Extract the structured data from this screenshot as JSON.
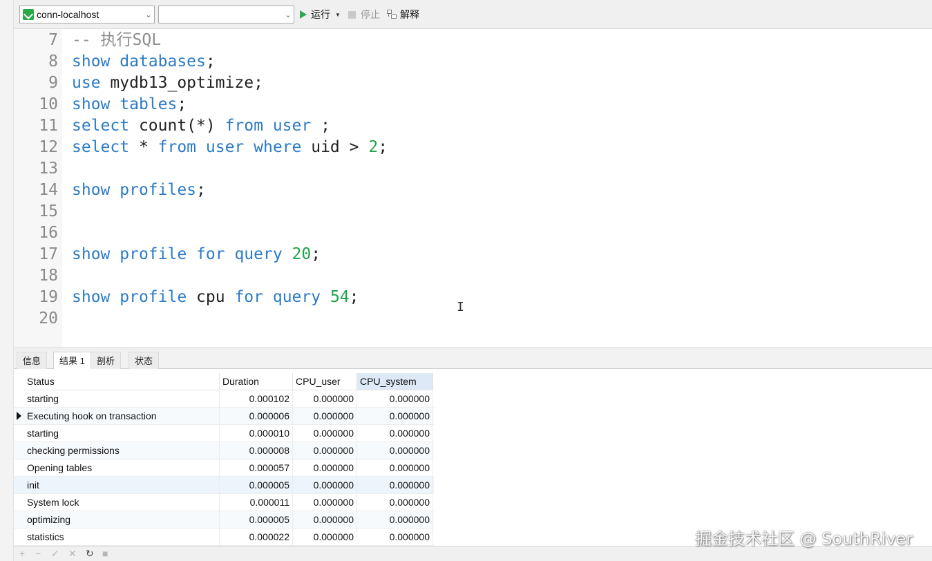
{
  "toolbar": {
    "connection": "conn-localhost",
    "database": "",
    "run_label": "运行",
    "stop_label": "停止",
    "explain_label": "解释"
  },
  "editor": {
    "lines": [
      {
        "num": "7",
        "tokens": [
          {
            "t": "-- 执行SQL",
            "c": "cm"
          }
        ]
      },
      {
        "num": "8",
        "tokens": [
          {
            "t": "show",
            "c": "kw"
          },
          {
            "t": " "
          },
          {
            "t": "databases",
            "c": "kw"
          },
          {
            "t": ";"
          }
        ]
      },
      {
        "num": "9",
        "tokens": [
          {
            "t": "use",
            "c": "kw"
          },
          {
            "t": " mydb13_optimize;"
          }
        ]
      },
      {
        "num": "10",
        "tokens": [
          {
            "t": "show",
            "c": "kw"
          },
          {
            "t": " "
          },
          {
            "t": "tables",
            "c": "kw"
          },
          {
            "t": ";"
          }
        ]
      },
      {
        "num": "11",
        "tokens": [
          {
            "t": "select",
            "c": "kw"
          },
          {
            "t": " count(*) "
          },
          {
            "t": "from",
            "c": "kw"
          },
          {
            "t": " "
          },
          {
            "t": "user",
            "c": "kw"
          },
          {
            "t": " ;"
          }
        ]
      },
      {
        "num": "12",
        "tokens": [
          {
            "t": "select",
            "c": "kw"
          },
          {
            "t": " * "
          },
          {
            "t": "from",
            "c": "kw"
          },
          {
            "t": " "
          },
          {
            "t": "user",
            "c": "kw"
          },
          {
            "t": " "
          },
          {
            "t": "where",
            "c": "kw"
          },
          {
            "t": " uid > "
          },
          {
            "t": "2",
            "c": "num"
          },
          {
            "t": ";"
          }
        ]
      },
      {
        "num": "13",
        "tokens": []
      },
      {
        "num": "14",
        "tokens": [
          {
            "t": "show",
            "c": "kw"
          },
          {
            "t": " "
          },
          {
            "t": "profiles",
            "c": "kw"
          },
          {
            "t": ";"
          }
        ]
      },
      {
        "num": "15",
        "tokens": []
      },
      {
        "num": "16",
        "tokens": []
      },
      {
        "num": "17",
        "tokens": [
          {
            "t": "show",
            "c": "kw"
          },
          {
            "t": " "
          },
          {
            "t": "profile",
            "c": "kw"
          },
          {
            "t": " "
          },
          {
            "t": "for",
            "c": "kw"
          },
          {
            "t": " "
          },
          {
            "t": "query",
            "c": "kw"
          },
          {
            "t": " "
          },
          {
            "t": "20",
            "c": "num"
          },
          {
            "t": ";"
          }
        ]
      },
      {
        "num": "18",
        "tokens": []
      },
      {
        "num": "19",
        "tokens": [
          {
            "t": "show",
            "c": "kw"
          },
          {
            "t": " "
          },
          {
            "t": "profile",
            "c": "kw"
          },
          {
            "t": " cpu "
          },
          {
            "t": "for",
            "c": "kw"
          },
          {
            "t": " "
          },
          {
            "t": "query",
            "c": "kw"
          },
          {
            "t": " "
          },
          {
            "t": "54",
            "c": "num"
          },
          {
            "t": ";"
          }
        ]
      },
      {
        "num": "20",
        "tokens": []
      }
    ]
  },
  "tabs": {
    "info": "信息",
    "result1": "结果 1",
    "profile": "剖析",
    "status": "状态"
  },
  "grid": {
    "columns": [
      "Status",
      "Duration",
      "CPU_user",
      "CPU_system"
    ],
    "rows": [
      [
        "starting",
        "0.000102",
        "0.000000",
        "0.000000"
      ],
      [
        "Executing hook on transaction",
        "0.000006",
        "0.000000",
        "0.000000"
      ],
      [
        "starting",
        "0.000010",
        "0.000000",
        "0.000000"
      ],
      [
        "checking permissions",
        "0.000008",
        "0.000000",
        "0.000000"
      ],
      [
        "Opening tables",
        "0.000057",
        "0.000000",
        "0.000000"
      ],
      [
        "init",
        "0.000005",
        "0.000000",
        "0.000000"
      ],
      [
        "System lock",
        "0.000011",
        "0.000000",
        "0.000000"
      ],
      [
        "optimizing",
        "0.000005",
        "0.000000",
        "0.000000"
      ],
      [
        "statistics",
        "0.000022",
        "0.000000",
        "0.000000"
      ]
    ]
  },
  "watermark": "掘金技术社区 @ SouthRiver",
  "colors": {
    "keyword": "#2b7bc6",
    "number": "#1fa34a",
    "comment": "#8d8d8d",
    "run_green": "#2fa84f"
  }
}
